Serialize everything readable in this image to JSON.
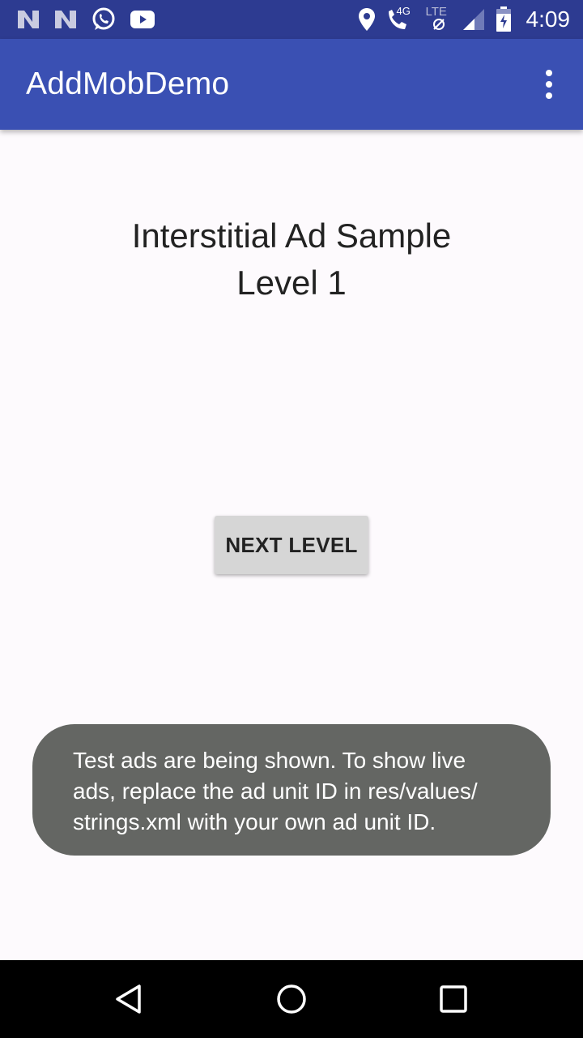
{
  "status_bar": {
    "time": "4:09",
    "network_label": "4G",
    "lte_label": "LTE",
    "left_icons": [
      "notification-n-icon",
      "notification-n-icon",
      "whatsapp-icon",
      "youtube-icon"
    ],
    "right_icons": [
      "location-icon",
      "call-4g-icon",
      "lte-icon",
      "signal-icon",
      "battery-charging-icon"
    ]
  },
  "app_bar": {
    "title": "AddMobDemo",
    "overflow_icon": "more-vert-icon"
  },
  "content": {
    "title_line1": "Interstitial Ad Sample",
    "title_line2": "Level 1",
    "next_button_label": "NEXT LEVEL"
  },
  "toast": {
    "line1": "Test ads are being shown. To show live",
    "line2": "ads, replace the ad unit ID in res/values/",
    "line3": "strings.xml with your own ad unit ID."
  },
  "nav_bar": {
    "icons": [
      "back-icon",
      "home-icon",
      "recents-icon"
    ]
  },
  "colors": {
    "status_bar": "#2d3b91",
    "app_bar": "#3a50b3",
    "background": "#fdfafd",
    "button": "#d6d6d6",
    "toast": "#646663"
  }
}
